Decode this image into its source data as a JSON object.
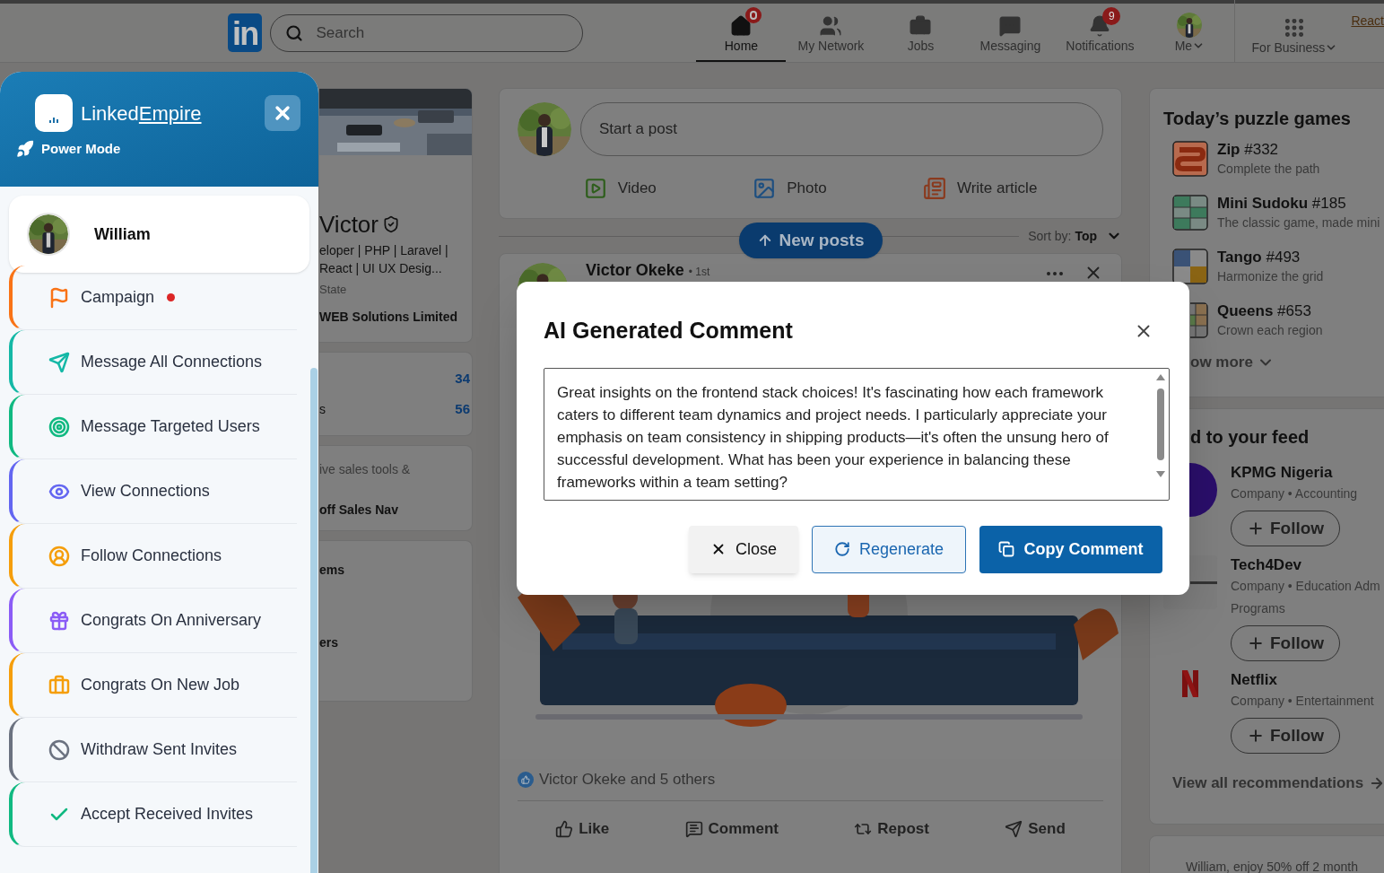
{
  "nav": {
    "logo_text": "in",
    "search_placeholder": "Search",
    "items": [
      {
        "label": "Home",
        "selected": true,
        "alert": true
      },
      {
        "label": "My Network",
        "selected": false
      },
      {
        "label": "Jobs",
        "selected": false
      },
      {
        "label": "Messaging",
        "selected": false
      },
      {
        "label": "Notifications",
        "selected": false,
        "count": "9"
      },
      {
        "label": "Me",
        "selected": false,
        "dropdown": true
      }
    ],
    "business": {
      "label": "For Business",
      "dropdown": true
    },
    "link": "React"
  },
  "profile": {
    "name": "Victor",
    "headline_lines": [
      "eloper | PHP | Laravel |",
      "React | UI UX Desig..."
    ],
    "location": "State",
    "company": "WEB Solutions Limited"
  },
  "stats": [
    {
      "value": "34"
    },
    {
      "label": "s",
      "value": "56"
    }
  ],
  "premium_lines": [
    "ive sales tools &",
    "off Sales Nav"
  ],
  "shortcuts": [
    "ems",
    "ers"
  ],
  "composer": {
    "placeholder": "Start a post",
    "actions": [
      "Video",
      "Photo",
      "Write article"
    ]
  },
  "sort": {
    "label": "Sort by:",
    "value": "Top"
  },
  "new_posts": "New posts",
  "post": {
    "author": "Victor Okeke",
    "degree": "• 1st",
    "reactions": "Victor Okeke and 5 others",
    "actions": [
      "Like",
      "Comment",
      "Repost",
      "Send"
    ]
  },
  "puzzles": {
    "title": "Today’s puzzle games",
    "games": [
      {
        "name": "Zip",
        "number": "#332",
        "subtitle": "Complete the path"
      },
      {
        "name": "Mini Sudoku",
        "number": "#185",
        "subtitle": "The classic game, made mini"
      },
      {
        "name": "Tango",
        "number": "#493",
        "subtitle": "Harmonize the grid"
      },
      {
        "name": "Queens",
        "number": "#653",
        "subtitle": "Crown each region"
      }
    ],
    "show_more": "ow more"
  },
  "feed": {
    "title": "d to your feed",
    "companies": [
      {
        "name": "KPMG Nigeria",
        "desc": "Company • Accounting",
        "follow": "Follow"
      },
      {
        "name": "Tech4Dev",
        "desc": "Company • Education Adm",
        "desc_2": "Programs",
        "follow": "Follow"
      },
      {
        "name": "Netflix",
        "desc": "Company • Entertainment",
        "follow": "Follow"
      }
    ],
    "view_all": "View all recommendations"
  },
  "promo": "William, enjoy 50% off 2 month",
  "panel": {
    "brand_first": "Linked",
    "brand_second": "Empire",
    "mode": "Power Mode",
    "user": "William",
    "items": [
      {
        "label": "Campaign",
        "color": "#f97316",
        "dot": true
      },
      {
        "label": "Message All Connections",
        "color": "#14b8a6",
        "dot": false
      },
      {
        "label": "Message Targeted Users",
        "color": "#10b981",
        "dot": false
      },
      {
        "label": "View Connections",
        "color": "#6366f1",
        "dot": false
      },
      {
        "label": "Follow Connections",
        "color": "#f59e0b",
        "dot": false
      },
      {
        "label": "Congrats On Anniversary",
        "color": "#8b5cf6",
        "dot": false
      },
      {
        "label": "Congrats On New Job",
        "color": "#f59e0b",
        "dot": false
      },
      {
        "label": "Withdraw Sent Invites",
        "color": "#6b7280",
        "dot": false
      },
      {
        "label": "Accept Received Invites",
        "color": "#10b981",
        "dot": false
      }
    ]
  },
  "modal": {
    "title": "AI Generated Comment",
    "comment": "Great insights on the frontend stack choices! It's fascinating how each framework caters to different team dynamics and project needs. I particularly appreciate your emphasis on team consistency in shipping products—it's often the unsung hero of successful development. What has been your experience in balancing these frameworks within a team setting?",
    "buttons": [
      {
        "label": "Close",
        "kind": "secondary"
      },
      {
        "label": "Regenerate",
        "kind": "outline"
      },
      {
        "label": "Copy Comment",
        "kind": "primary"
      }
    ]
  }
}
